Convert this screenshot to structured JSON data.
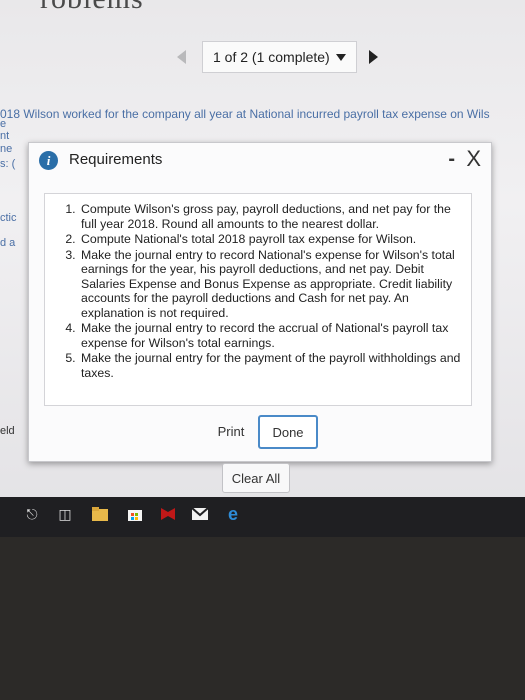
{
  "page_heading": "roblems",
  "pager": {
    "label": "1 of 2 (1 complete)"
  },
  "background_text": {
    "line": "018 Wilson worked for the company all year at    National incurred payroll tax expense on Wils",
    "left_fragments": [
      "e",
      "nt",
      "ne",
      "s: (",
      "ctic",
      "d a",
      "eld"
    ]
  },
  "modal": {
    "title": "Requirements",
    "minimize_label": "-",
    "close_label": "X",
    "requirements": [
      "Compute Wilson's gross pay, payroll deductions, and net pay for the full year 2018. Round all amounts to the nearest dollar.",
      "Compute National's total 2018 payroll tax expense for Wilson.",
      "Make the journal entry to record National's expense for Wilson's total earnings for the year, his payroll deductions, and net pay. Debit Salaries Expense and Bonus Expense as appropriate. Credit liability accounts for the payroll deductions and Cash for net pay. An explanation is not required.",
      "Make the journal entry to record the accrual of National's payroll tax expense for Wilson's total earnings.",
      "Make the journal entry for the payment of the payroll withholdings and taxes."
    ],
    "print_label": "Print",
    "done_label": "Done"
  },
  "clear_all_label": "Clear All",
  "taskbar_icons": [
    "microphone-icon",
    "task-view-icon",
    "file-explorer-icon",
    "store-icon",
    "mcafee-icon",
    "mail-icon",
    "edge-icon"
  ]
}
